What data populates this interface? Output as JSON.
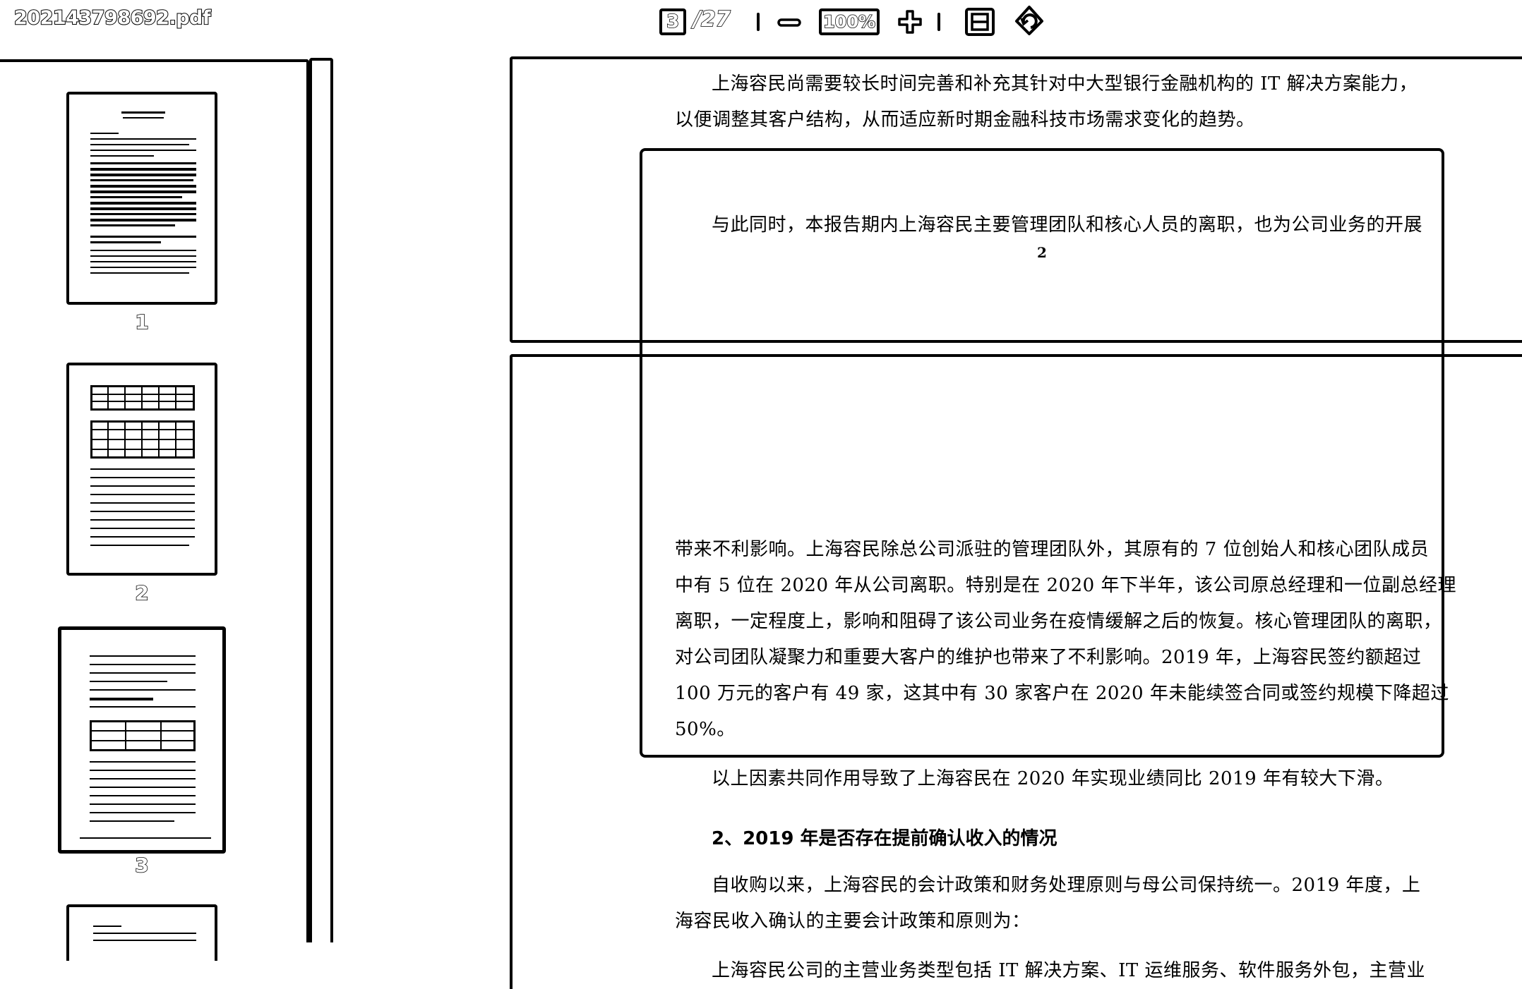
{
  "toolbar": {
    "filename": "202143798692.pdf",
    "page_current": "3",
    "page_total": "/27",
    "zoom_level": "100%",
    "icons": [
      "zoom-out-icon",
      "zoom-in-icon",
      "fit-page-icon",
      "rotate-icon"
    ]
  },
  "sidebar": {
    "thumbnails": [
      {
        "label": "1"
      },
      {
        "label": "2"
      },
      {
        "label": "3"
      }
    ]
  },
  "document": {
    "page_top": {
      "line1": "上海容民尚需要较长时间完善和补充其针对中大型银行金融机构的 IT 解决方案能力，",
      "line2": "以便调整其客户结构，从而适应新时期金融科技市场需求变化的趋势。",
      "line3": "与此同时，本报告期内上海容民主要管理团队和核心人员的离职，也为公司业务的开展",
      "page_number": "2"
    },
    "page_next": {
      "para1": [
        "带来不利影响。上海容民除总公司派驻的管理团队外，其原有的 7 位创始人和核心团队成员",
        "中有 5 位在 2020 年从公司离职。特别是在 2020 年下半年，该公司原总经理和一位副总经理",
        "离职，一定程度上，影响和阻碍了该公司业务在疫情缓解之后的恢复。核心管理团队的离职，",
        "对公司团队凝聚力和重要大客户的维护也带来了不利影响。2019 年，上海容民签约额超过",
        "100 万元的客户有 49 家，这其中有 30 家客户在 2020 年未能续签合同或签约规模下降超过",
        "50%。"
      ],
      "para2": "以上因素共同作用导致了上海容民在 2020 年实现业绩同比 2019 年有较大下滑。",
      "heading": "2、2019 年是否存在提前确认收入的情况",
      "para3": [
        "自收购以来，上海容民的会计政策和财务处理原则与母公司保持统一。2019 年度，上",
        "海容民收入确认的主要会计政策和原则为："
      ],
      "para4": "上海容民公司的主营业务类型包括 IT 解决方案、IT 运维服务、软件服务外包，主营业"
    }
  }
}
